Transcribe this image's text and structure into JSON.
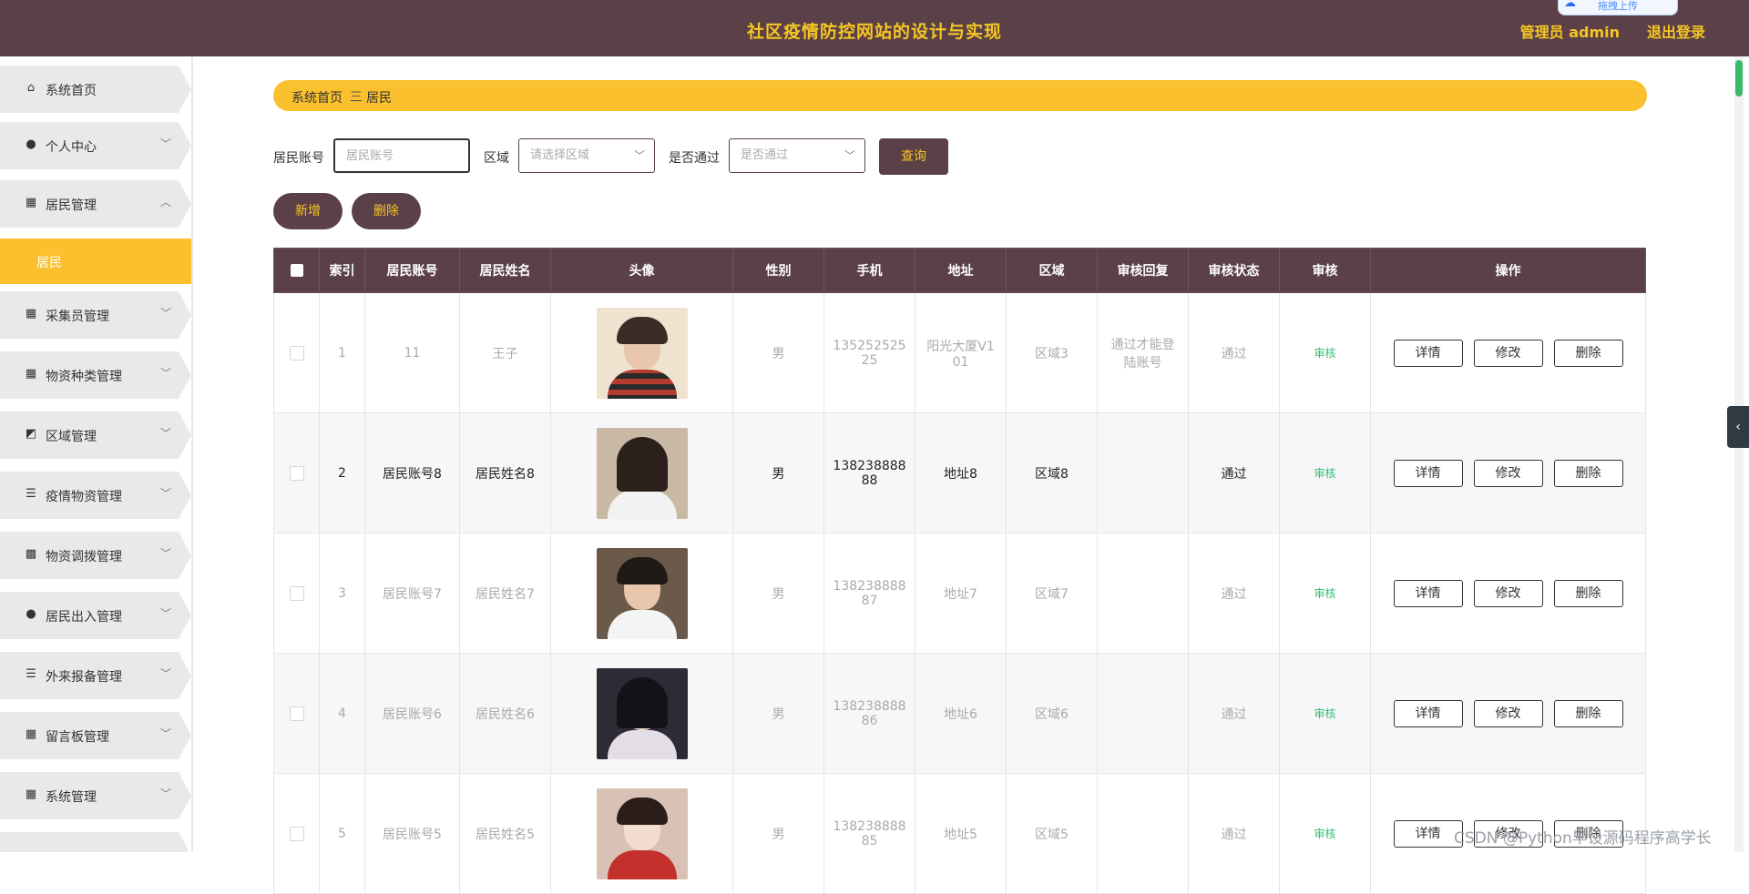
{
  "header": {
    "title": "社区疫情防控网站的设计与实现",
    "user": "管理员 admin",
    "logout": "退出登录",
    "upload_chip": "拖拽上传"
  },
  "sidebar": {
    "items": [
      {
        "label": "系统首页",
        "icon": "home-icon"
      },
      {
        "label": "个人中心",
        "icon": "user-icon"
      },
      {
        "label": "居民管理",
        "icon": "grid-icon"
      },
      {
        "label": "采集员管理",
        "icon": "grid-icon"
      },
      {
        "label": "物资种类管理",
        "icon": "grid-icon"
      },
      {
        "label": "区域管理",
        "icon": "chart-icon"
      },
      {
        "label": "疫情物资管理",
        "icon": "list-icon"
      },
      {
        "label": "物资调拨管理",
        "icon": "apps-icon"
      },
      {
        "label": "居民出入管理",
        "icon": "user-icon"
      },
      {
        "label": "外来报备管理",
        "icon": "list-icon"
      },
      {
        "label": "留言板管理",
        "icon": "grid-icon"
      },
      {
        "label": "系统管理",
        "icon": "grid-icon"
      }
    ],
    "active_sub": "居民"
  },
  "breadcrumb": {
    "home": "系统首页",
    "separator": "三",
    "current": "居民"
  },
  "search": {
    "account_label": "居民账号",
    "account_placeholder": "居民账号",
    "region_label": "区域",
    "region_placeholder": "请选择区域",
    "pass_label": "是否通过",
    "pass_placeholder": "是否通过",
    "query_button": "查询"
  },
  "actions": {
    "add": "新增",
    "delete": "删除"
  },
  "table": {
    "headers": [
      "索引",
      "居民账号",
      "居民姓名",
      "头像",
      "性别",
      "手机",
      "地址",
      "区域",
      "审核回复",
      "审核状态",
      "审核",
      "操作"
    ],
    "rows": [
      {
        "index": "1",
        "account": "11",
        "name": "王子",
        "gender": "男",
        "phone": "135252525 25",
        "address": "阳光大厦V1 01",
        "region": "区域3",
        "reply": "通过才能登 陆账号",
        "status": "通过",
        "audit": "审核",
        "tone": "light"
      },
      {
        "index": "2",
        "account": "居民账号8",
        "name": "居民姓名8",
        "gender": "男",
        "phone": "138238888 88",
        "address": "地址8",
        "region": "区域8",
        "reply": "",
        "status": "通过",
        "audit": "审核",
        "tone": "dark"
      },
      {
        "index": "3",
        "account": "居民账号7",
        "name": "居民姓名7",
        "gender": "男",
        "phone": "138238888 87",
        "address": "地址7",
        "region": "区域7",
        "reply": "",
        "status": "通过",
        "audit": "审核",
        "tone": "light"
      },
      {
        "index": "4",
        "account": "居民账号6",
        "name": "居民姓名6",
        "gender": "男",
        "phone": "138238888 86",
        "address": "地址6",
        "region": "区域6",
        "reply": "",
        "status": "通过",
        "audit": "审核",
        "tone": "light"
      },
      {
        "index": "5",
        "account": "居民账号5",
        "name": "居民姓名5",
        "gender": "男",
        "phone": "138238888 85",
        "address": "地址5",
        "region": "区域5",
        "reply": "",
        "status": "通过",
        "audit": "审核",
        "tone": "light"
      }
    ],
    "op_buttons": {
      "detail": "详情",
      "edit": "修改",
      "delete": "删除"
    }
  },
  "watermark": "CSDN @Python毕设源码程序高学长",
  "colors": {
    "header": "#5b4047",
    "accent": "#fbc02d",
    "title": "#f5c623",
    "audit_link": "#2fbf72"
  }
}
